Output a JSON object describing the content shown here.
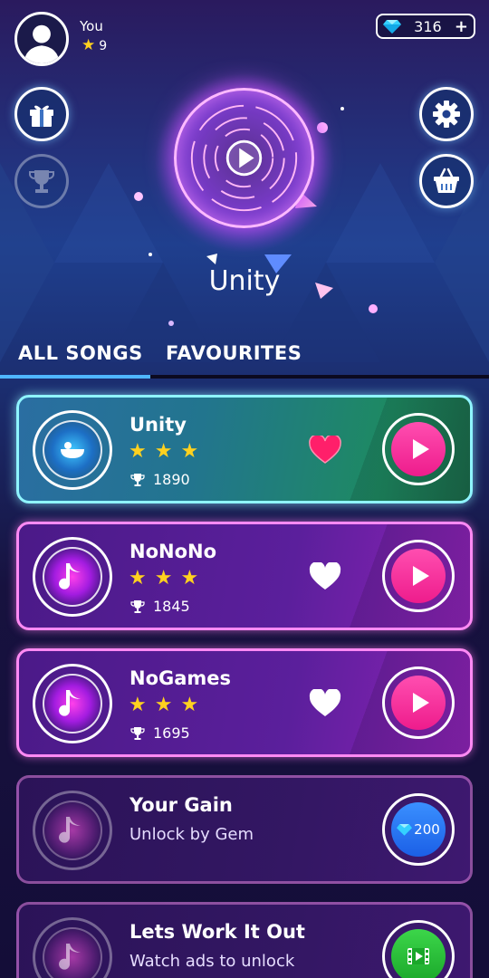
{
  "player": {
    "name": "You",
    "stars": "9",
    "gems": "316"
  },
  "now_playing": {
    "title": "Unity"
  },
  "tabs": [
    {
      "label": "ALL SONGS",
      "active": true
    },
    {
      "label": "FAVOURITES",
      "active": false
    }
  ],
  "songs": [
    {
      "name": "Unity",
      "stars": 3,
      "score": "1890",
      "favourite": true,
      "state": "playing"
    },
    {
      "name": "NoNoNo",
      "stars": 3,
      "score": "1845",
      "favourite": false,
      "state": "unlocked"
    },
    {
      "name": "NoGames",
      "stars": 3,
      "score": "1695",
      "favourite": false,
      "state": "unlocked"
    },
    {
      "name": "Your Gain",
      "subtitle": "Unlock by Gem",
      "price": "200",
      "state": "locked-gem"
    },
    {
      "name": "Lets Work It Out",
      "subtitle": "Watch ads to unlock",
      "state": "locked-ad"
    }
  ],
  "colors": {
    "accent_pink": "#ff4eb0",
    "accent_cyan": "#8ff5ff",
    "star_gold": "#ffd11f",
    "heart_red": "#ff1f6a"
  }
}
